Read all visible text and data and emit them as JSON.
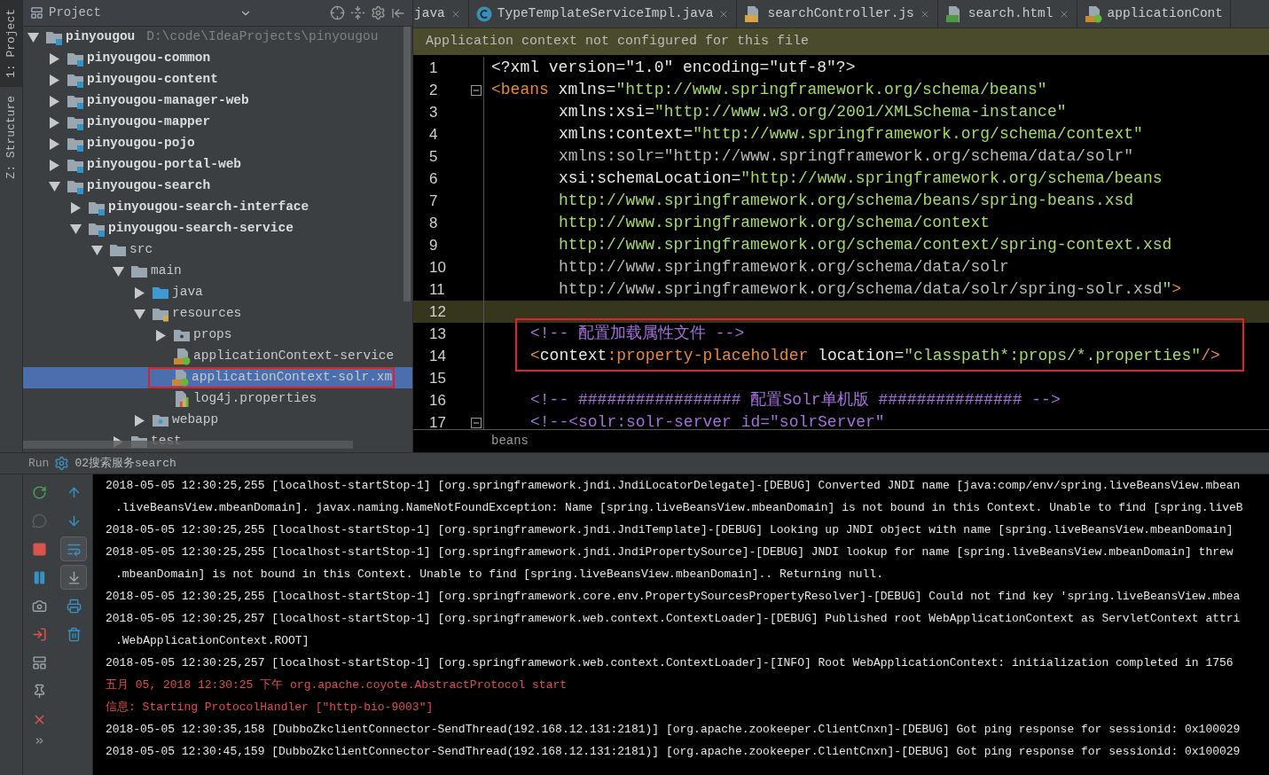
{
  "side_tabs": [
    {
      "label": "1: Project",
      "selected": true
    },
    {
      "label": "Z: Structure",
      "selected": false
    }
  ],
  "project_panel": {
    "title": "Project",
    "tree": [
      {
        "label": "pinyougou",
        "path": "D:\\code\\IdeaProjects\\pinyougou",
        "kind": "module",
        "expanded": true,
        "selected": false,
        "boxed": false,
        "children": [
          {
            "label": "pinyougou-common",
            "kind": "module",
            "expanded": false,
            "selected": false,
            "boxed": false
          },
          {
            "label": "pinyougou-content",
            "kind": "module",
            "expanded": false,
            "selected": false,
            "boxed": false
          },
          {
            "label": "pinyougou-manager-web",
            "kind": "module",
            "expanded": false,
            "selected": false,
            "boxed": false
          },
          {
            "label": "pinyougou-mapper",
            "kind": "module",
            "expanded": false,
            "selected": false,
            "boxed": false
          },
          {
            "label": "pinyougou-pojo",
            "kind": "module",
            "expanded": false,
            "selected": false,
            "boxed": false
          },
          {
            "label": "pinyougou-portal-web",
            "kind": "module",
            "expanded": false,
            "selected": false,
            "boxed": false
          },
          {
            "label": "pinyougou-search",
            "kind": "module",
            "expanded": true,
            "selected": false,
            "boxed": false,
            "children": [
              {
                "label": "pinyougou-search-interface",
                "kind": "module",
                "expanded": false,
                "selected": false,
                "boxed": false
              },
              {
                "label": "pinyougou-search-service",
                "kind": "module",
                "expanded": true,
                "selected": false,
                "boxed": false,
                "children": [
                  {
                    "label": "src",
                    "kind": "folder",
                    "expanded": true,
                    "selected": false,
                    "boxed": false,
                    "children": [
                      {
                        "label": "main",
                        "kind": "folder",
                        "expanded": true,
                        "selected": false,
                        "boxed": false,
                        "children": [
                          {
                            "label": "java",
                            "kind": "source",
                            "expanded": false,
                            "selected": false,
                            "boxed": false
                          },
                          {
                            "label": "resources",
                            "kind": "resources",
                            "expanded": true,
                            "selected": false,
                            "boxed": false,
                            "children": [
                              {
                                "label": "props",
                                "kind": "package",
                                "expanded": false,
                                "selected": false,
                                "boxed": false
                              },
                              {
                                "label": "applicationContext-service",
                                "kind": "xml",
                                "selected": false,
                                "boxed": false
                              },
                              {
                                "label": "applicationContext-solr.xm",
                                "kind": "xml",
                                "selected": true,
                                "boxed": true
                              },
                              {
                                "label": "log4j.properties",
                                "kind": "properties",
                                "selected": false,
                                "boxed": false
                              }
                            ]
                          },
                          {
                            "label": "webapp",
                            "kind": "web",
                            "expanded": false,
                            "selected": false,
                            "boxed": false
                          }
                        ]
                      },
                      {
                        "label": "test",
                        "kind": "folder",
                        "expanded": false,
                        "selected": false,
                        "boxed": false
                      }
                    ]
                  }
                ]
              }
            ]
          }
        ]
      }
    ]
  },
  "editor": {
    "tabs": [
      {
        "label": "java",
        "kind": "plain",
        "closable": true
      },
      {
        "label": "TypeTemplateServiceImpl.java",
        "kind": "class",
        "closable": true
      },
      {
        "label": "searchController.js",
        "kind": "js",
        "closable": true
      },
      {
        "label": "search.html",
        "kind": "html",
        "closable": true
      },
      {
        "label": "applicationCont",
        "kind": "xml",
        "closable": false
      }
    ],
    "banner": "Application context not configured for this file",
    "lines": [
      {
        "n": "1",
        "kind": "top",
        "current": false,
        "boxed": false,
        "fold": false,
        "segments": [
          {
            "kind": "plain",
            "text": "<?xml version=\"1.0\" encoding=\"utf-8\"?>"
          }
        ]
      },
      {
        "n": "2",
        "kind": "top",
        "current": false,
        "boxed": false,
        "fold": true,
        "segments": [
          {
            "kind": "tag",
            "text": "<beans"
          },
          {
            "kind": "plain",
            "text": " xmlns="
          },
          {
            "kind": "value",
            "text": "\"http://www.springframework.org/schema/beans\""
          }
        ]
      },
      {
        "n": "3",
        "kind": "attr",
        "current": false,
        "boxed": false,
        "fold": false,
        "segments": [
          {
            "kind": "plain",
            "text": "xmlns:xsi="
          },
          {
            "kind": "value",
            "text": "\"http://www.w3.org/2001/XMLSchema-instance\""
          }
        ]
      },
      {
        "n": "4",
        "kind": "attr",
        "current": false,
        "boxed": false,
        "fold": false,
        "segments": [
          {
            "kind": "plain",
            "text": "xmlns:context="
          },
          {
            "kind": "value",
            "text": "\"http://www.springframework.org/schema/context\""
          }
        ]
      },
      {
        "n": "5",
        "kind": "attr",
        "current": false,
        "boxed": false,
        "fold": false,
        "segments": [
          {
            "kind": "dim",
            "text": "xmlns:solr=\"http://www.springframework.org/schema/data/solr\""
          }
        ]
      },
      {
        "n": "6",
        "kind": "attr",
        "current": false,
        "boxed": false,
        "fold": false,
        "segments": [
          {
            "kind": "plain",
            "text": "xsi:schemaLocation="
          },
          {
            "kind": "value",
            "text": "\"http://www.springframework.org/schema/beans"
          }
        ]
      },
      {
        "n": "7",
        "kind": "attr",
        "current": false,
        "boxed": false,
        "fold": false,
        "segments": [
          {
            "kind": "value",
            "text": "http://www.springframework.org/schema/beans/spring-beans.xsd"
          }
        ]
      },
      {
        "n": "8",
        "kind": "attr",
        "current": false,
        "boxed": false,
        "fold": false,
        "segments": [
          {
            "kind": "value",
            "text": "http://www.springframework.org/schema/context"
          }
        ]
      },
      {
        "n": "9",
        "kind": "attr",
        "current": false,
        "boxed": false,
        "fold": false,
        "segments": [
          {
            "kind": "value",
            "text": "http://www.springframework.org/schema/context/spring-context.xsd"
          }
        ]
      },
      {
        "n": "10",
        "kind": "attr",
        "current": false,
        "boxed": false,
        "fold": false,
        "segments": [
          {
            "kind": "dim",
            "text": "http://www.springframework.org/schema/data/solr"
          }
        ]
      },
      {
        "n": "11",
        "kind": "attr",
        "current": false,
        "boxed": false,
        "fold": false,
        "segments": [
          {
            "kind": "dim",
            "text": "http://www.springframework.org/schema/data/solr/spring-solr.xsd"
          },
          {
            "kind": "value",
            "text": "\""
          },
          {
            "kind": "tag",
            "text": ">"
          }
        ]
      },
      {
        "n": "12",
        "current": true,
        "boxed": false,
        "fold": false
      },
      {
        "n": "13",
        "kind": "child",
        "current": false,
        "boxed": true,
        "fold": false,
        "segments": [
          {
            "kind": "comment",
            "text": "<!-- 配置加载属性文件 -->"
          }
        ]
      },
      {
        "n": "14",
        "kind": "child",
        "current": false,
        "boxed": true,
        "fold": false,
        "segments": [
          {
            "kind": "tag",
            "text": "<"
          },
          {
            "kind": "plain",
            "text": "context"
          },
          {
            "kind": "tag",
            "text": ":property-placeholder"
          },
          {
            "kind": "plain",
            "text": " location="
          },
          {
            "kind": "value",
            "text": "\"classpath*:props/*.properties\""
          },
          {
            "kind": "tag",
            "text": "/>"
          }
        ]
      },
      {
        "n": "15",
        "current": false,
        "boxed": false,
        "fold": false
      },
      {
        "n": "16",
        "kind": "child",
        "current": false,
        "boxed": false,
        "fold": false,
        "segments": [
          {
            "kind": "comment",
            "text": "<!-- ################# 配置Solr单机版 ############### -->"
          }
        ]
      },
      {
        "n": "17",
        "kind": "child",
        "current": false,
        "boxed": false,
        "fold": true,
        "segments": [
          {
            "kind": "comment",
            "text": "<!--<solr:solr-server id=\"solrServer\""
          }
        ]
      }
    ],
    "breadcrumb": "beans"
  },
  "run_panel": {
    "label": "Run",
    "config": "02搜索服务search",
    "console": [
      {
        "kind": "log",
        "text": "2018-05-05 12:30:25,255 [localhost-startStop-1] [org.springframework.jndi.JndiLocatorDelegate]-[DEBUG] Converted JNDI name [java:comp/env/spring.liveBeansView.mbean"
      },
      {
        "kind": "wrap",
        "text": ".liveBeansView.mbeanDomain]. javax.naming.NameNotFoundException: Name [spring.liveBeansView.mbeanDomain] is not bound in this Context. Unable to find [spring.liveB"
      },
      {
        "kind": "log",
        "text": "2018-05-05 12:30:25,255 [localhost-startStop-1] [org.springframework.jndi.JndiTemplate]-[DEBUG] Looking up JNDI object with name [spring.liveBeansView.mbeanDomain]"
      },
      {
        "kind": "log",
        "text": "2018-05-05 12:30:25,255 [localhost-startStop-1] [org.springframework.jndi.JndiPropertySource]-[DEBUG] JNDI lookup for name [spring.liveBeansView.mbeanDomain] threw"
      },
      {
        "kind": "wrap",
        "text": ".mbeanDomain] is not bound in this Context. Unable to find [spring.liveBeansView.mbeanDomain].. Returning null."
      },
      {
        "kind": "log",
        "text": "2018-05-05 12:30:25,255 [localhost-startStop-1] [org.springframework.core.env.PropertySourcesPropertyResolver]-[DEBUG] Could not find key 'spring.liveBeansView.mbea"
      },
      {
        "kind": "log",
        "text": "2018-05-05 12:30:25,257 [localhost-startStop-1] [org.springframework.web.context.ContextLoader]-[DEBUG] Published root WebApplicationContext as ServletContext attri"
      },
      {
        "kind": "wrap",
        "text": ".WebApplicationContext.ROOT]"
      },
      {
        "kind": "log",
        "text": "2018-05-05 12:30:25,257 [localhost-startStop-1] [org.springframework.web.context.ContextLoader]-[INFO] Root WebApplicationContext: initialization completed in 1756"
      },
      {
        "kind": "error",
        "text": "五月 05, 2018 12:30:25 下午 org.apache.coyote.AbstractProtocol start"
      },
      {
        "kind": "error",
        "text": "信息: Starting ProtocolHandler [\"http-bio-9003\"]"
      },
      {
        "kind": "log",
        "text": "2018-05-05 12:30:35,158 [DubboZkclientConnector-SendThread(192.168.12.131:2181)] [org.apache.zookeeper.ClientCnxn]-[DEBUG] Got ping response for sessionid: 0x100029"
      },
      {
        "kind": "log",
        "text": "2018-05-05 12:30:45,159 [DubboZkclientConnector-SendThread(192.168.12.131:2181)] [org.apache.zookeeper.ClientCnxn]-[DEBUG] Got ping response for sessionid: 0x100029"
      }
    ]
  }
}
